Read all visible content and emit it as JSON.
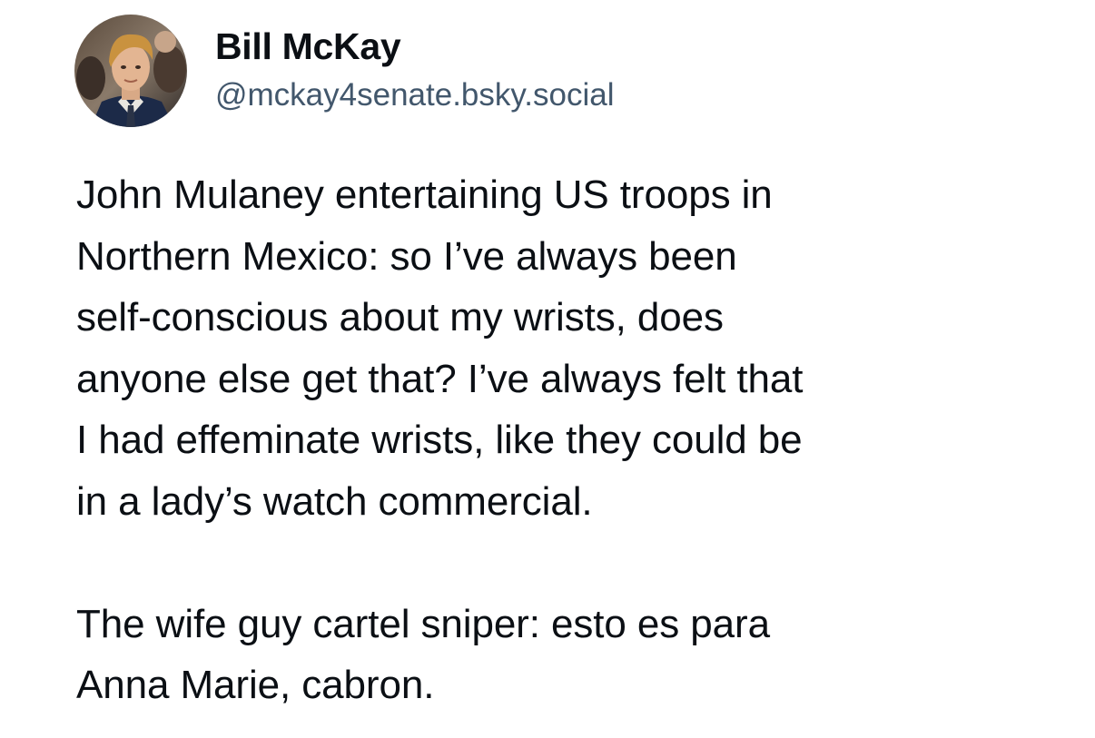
{
  "author": {
    "display_name": "Bill McKay",
    "handle": "@mckay4senate.bsky.social",
    "avatar_icon": "user-avatar-photo"
  },
  "post": {
    "text": "John Mulaney entertaining US troops in\nNorthern Mexico: so I’ve always been\nself-conscious about my wrists, does\nanyone else get that? I’ve always felt that\nI had effeminate wrists, like they could be\nin a lady’s watch commercial.\n\nThe wife guy cartel sniper: esto es para\nAnna Marie, cabron."
  },
  "colors": {
    "text_primary": "#0b0f14",
    "text_secondary": "#42576c",
    "background": "#ffffff"
  }
}
